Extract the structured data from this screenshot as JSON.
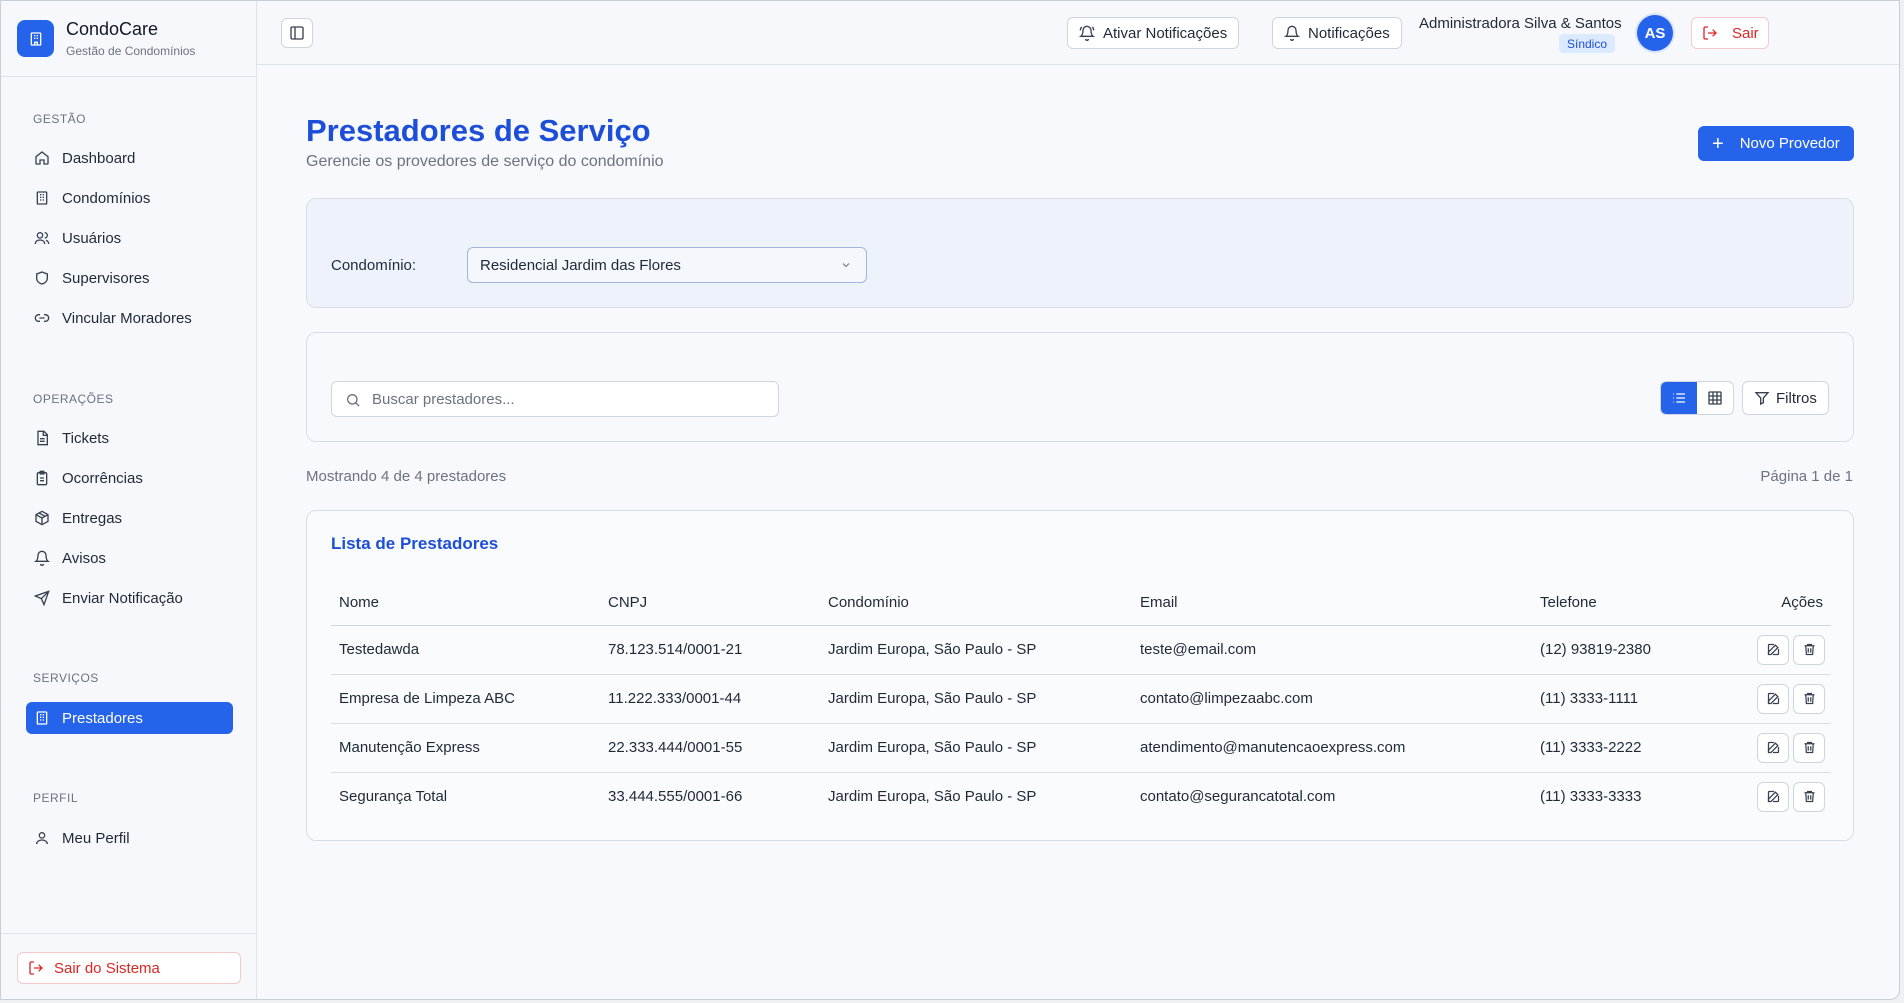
{
  "app": {
    "name": "CondoCare",
    "subtitle": "Gestão de Condomínios"
  },
  "sidebar": {
    "groups": [
      {
        "title": "GESTÃO",
        "items": [
          "Dashboard",
          "Condomínios",
          "Usuários",
          "Supervisores",
          "Vincular Moradores"
        ]
      },
      {
        "title": "OPERAÇÕES",
        "items": [
          "Tickets",
          "Ocorrências",
          "Entregas",
          "Avisos",
          "Enviar Notificação"
        ]
      },
      {
        "title": "SERVIÇOS",
        "items": [
          "Prestadores"
        ]
      },
      {
        "title": "PERFIL",
        "items": [
          "Meu Perfil"
        ]
      }
    ],
    "active_item": "Prestadores",
    "logout_label": "Sair do Sistema"
  },
  "header": {
    "enable_notifications_label": "Ativar Notificações",
    "notifications_label": "Notificações",
    "user_name": "Administradora Silva & Santos",
    "user_role": "Síndico",
    "avatar_initials": "AS",
    "logout_label": "Sair"
  },
  "page": {
    "title": "Prestadores de Serviço",
    "subtitle": "Gerencie os provedores de serviço do condomínio",
    "new_button_label": "Novo Provedor"
  },
  "filter": {
    "label": "Condomínio:",
    "selected": "Residencial Jardim das Flores"
  },
  "search": {
    "placeholder": "Buscar prestadores...",
    "filters_label": "Filtros",
    "active_view": "list"
  },
  "summary": {
    "showing": "Mostrando 4 de 4 prestadores",
    "page_info": "Página 1 de 1"
  },
  "table": {
    "title": "Lista de Prestadores",
    "columns": [
      "Nome",
      "CNPJ",
      "Condomínio",
      "Email",
      "Telefone",
      "Ações"
    ],
    "rows": [
      {
        "nome": "Testedawda",
        "cnpj": "78.123.514/0001-21",
        "condominio": "Jardim Europa, São Paulo - SP",
        "email": "teste@email.com",
        "telefone": "(12) 93819-2380"
      },
      {
        "nome": "Empresa de Limpeza ABC",
        "cnpj": "11.222.333/0001-44",
        "condominio": "Jardim Europa, São Paulo - SP",
        "email": "contato@limpezaabc.com",
        "telefone": "(11) 3333-1111"
      },
      {
        "nome": "Manutenção Express",
        "cnpj": "22.333.444/0001-55",
        "condominio": "Jardim Europa, São Paulo - SP",
        "email": "atendimento@manutencaoexpress.com",
        "telefone": "(11) 3333-2222"
      },
      {
        "nome": "Segurança Total",
        "cnpj": "33.444.555/0001-66",
        "condominio": "Jardim Europa, São Paulo - SP",
        "email": "contato@segurancatotal.com",
        "telefone": "(11) 3333-3333"
      }
    ]
  },
  "colors": {
    "primary": "#2563eb",
    "primary_text": "#1d4ed8",
    "danger": "#dc2626"
  }
}
